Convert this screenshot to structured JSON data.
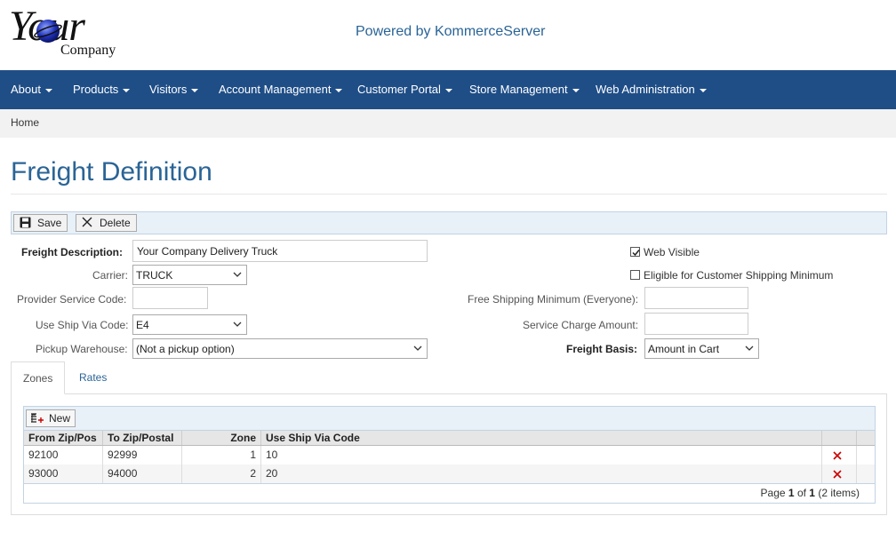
{
  "header": {
    "logo_word": "Your",
    "logo_sub": "Company",
    "powered_by": "Powered by KommerceServer"
  },
  "nav": {
    "items": [
      {
        "label": "About"
      },
      {
        "label": "Products"
      },
      {
        "label": "Visitors"
      },
      {
        "label": "Account Management"
      },
      {
        "label": "Customer Portal"
      },
      {
        "label": "Store Management"
      },
      {
        "label": "Web Administration"
      }
    ]
  },
  "breadcrumb": {
    "home": "Home"
  },
  "page": {
    "title": "Freight Definition"
  },
  "toolbar": {
    "save": "Save",
    "delete": "Delete"
  },
  "form": {
    "description_label": "Freight Description:",
    "description_value": "Your Company Delivery Truck",
    "carrier_label": "Carrier:",
    "carrier_value": "TRUCK",
    "provider_label": "Provider Service Code:",
    "provider_value": "",
    "ship_via_label": "Use Ship Via Code:",
    "ship_via_value": "E4",
    "pickup_label": "Pickup Warehouse:",
    "pickup_value": "(Not a pickup option)",
    "web_visible_label": "Web Visible",
    "web_visible_checked": true,
    "eligible_label": "Eligible for Customer Shipping Minimum",
    "eligible_checked": false,
    "free_ship_label": "Free Shipping Minimum (Everyone):",
    "free_ship_value": "",
    "service_charge_label": "Service Charge Amount:",
    "service_charge_value": "",
    "freight_basis_label": "Freight Basis:",
    "freight_basis_value": "Amount in Cart"
  },
  "tabs": [
    {
      "label": "Zones",
      "active": true
    },
    {
      "label": "Rates",
      "active": false
    }
  ],
  "grid": {
    "new_label": "New",
    "columns": [
      "From Zip/Pos",
      "To Zip/Postal",
      "Zone",
      "Use Ship Via Code"
    ],
    "rows": [
      {
        "from": "92100",
        "to": "92999",
        "zone": "1",
        "ship_via": "10"
      },
      {
        "from": "93000",
        "to": "94000",
        "zone": "2",
        "ship_via": "20"
      }
    ],
    "pager": {
      "prefix": "Page",
      "page": "1",
      "of": "of",
      "total": "1",
      "items": "(2 items)"
    }
  },
  "colors": {
    "nav_bg": "#1f4e87",
    "title": "#2a6496",
    "toolbar_bg": "#e8f0f8",
    "delete_x": "#cc0000"
  }
}
